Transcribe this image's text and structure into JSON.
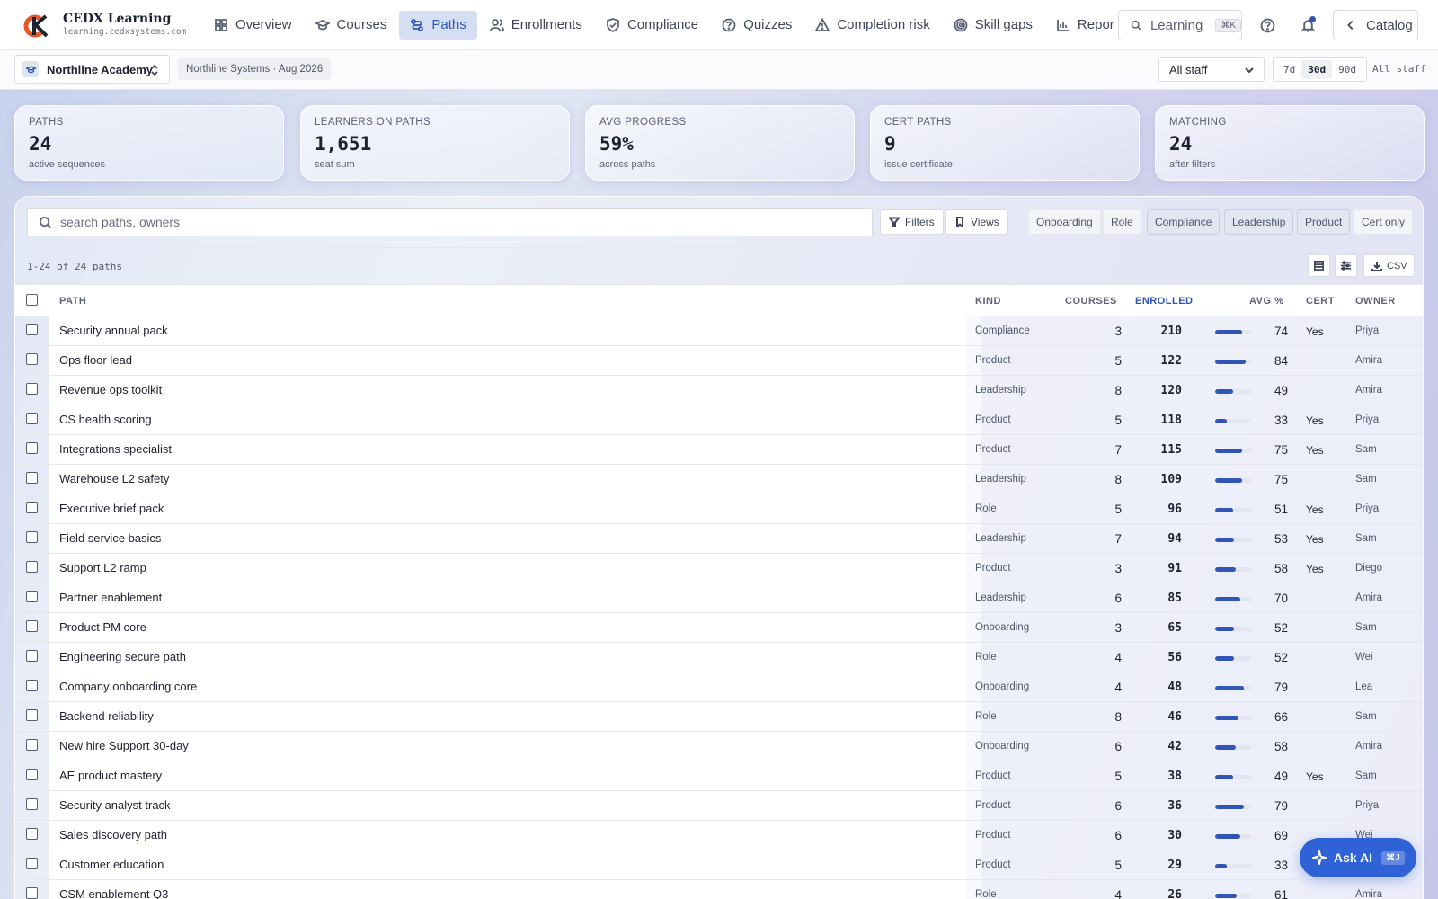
{
  "app": {
    "name": "CEDX Learning",
    "domain": "learning.cedxsystems.com"
  },
  "nav": {
    "items": [
      {
        "label": "Overview",
        "icon": "grid-icon"
      },
      {
        "label": "Courses",
        "icon": "graduation-cap-icon"
      },
      {
        "label": "Paths",
        "icon": "route-icon",
        "active": true
      },
      {
        "label": "Enrollments",
        "icon": "users-icon"
      },
      {
        "label": "Compliance",
        "icon": "shield-check-icon"
      },
      {
        "label": "Quizzes",
        "icon": "help-circle-icon"
      },
      {
        "label": "Completion risk",
        "icon": "alert-triangle-icon"
      },
      {
        "label": "Skill gaps",
        "icon": "target-icon"
      },
      {
        "label": "Repor",
        "icon": "bar-chart-icon"
      }
    ],
    "search_label": "Learning",
    "search_shortcut": "⌘K",
    "catalog_label": "Catalog"
  },
  "subbar": {
    "org": "Northline Academy",
    "org_tag": "Northline Systems · Aug 2026",
    "staff_filter": "All staff",
    "ranges": [
      "7d",
      "30d",
      "90d"
    ],
    "active_range": "30d",
    "range_label": "All staff"
  },
  "stats": [
    {
      "label": "PATHS",
      "value": "24",
      "sub": "active sequences"
    },
    {
      "label": "LEARNERS ON PATHS",
      "value": "1,651",
      "sub": "seat sum"
    },
    {
      "label": "AVG PROGRESS",
      "value": "59%",
      "sub": "across paths"
    },
    {
      "label": "CERT PATHS",
      "value": "9",
      "sub": "issue certificate"
    },
    {
      "label": "MATCHING",
      "value": "24",
      "sub": "after filters"
    }
  ],
  "toolbar": {
    "search_placeholder": "search paths, owners",
    "filters_label": "Filters",
    "views_label": "Views",
    "chips": [
      "Onboarding",
      "Role",
      "Compliance",
      "Leadership",
      "Product",
      "Cert only"
    ],
    "count_text": "1-24 of 24 paths",
    "csv_label": "CSV"
  },
  "table": {
    "columns": {
      "path": "PATH",
      "kind": "KIND",
      "courses": "COURSES",
      "enrolled": "ENROLLED",
      "avg": "AVG %",
      "cert": "CERT",
      "owner": "OWNER"
    },
    "rows": [
      {
        "path": "Security annual pack",
        "kind": "Compliance",
        "courses": "3",
        "enrolled": "210",
        "avg": "74",
        "cert": "Yes",
        "owner": "Priya"
      },
      {
        "path": "Ops floor lead",
        "kind": "Product",
        "courses": "5",
        "enrolled": "122",
        "avg": "84",
        "cert": "",
        "owner": "Amira"
      },
      {
        "path": "Revenue ops toolkit",
        "kind": "Leadership",
        "courses": "8",
        "enrolled": "120",
        "avg": "49",
        "cert": "",
        "owner": "Amira"
      },
      {
        "path": "CS health scoring",
        "kind": "Product",
        "courses": "5",
        "enrolled": "118",
        "avg": "33",
        "cert": "Yes",
        "owner": "Priya"
      },
      {
        "path": "Integrations specialist",
        "kind": "Product",
        "courses": "7",
        "enrolled": "115",
        "avg": "75",
        "cert": "Yes",
        "owner": "Sam"
      },
      {
        "path": "Warehouse L2 safety",
        "kind": "Leadership",
        "courses": "8",
        "enrolled": "109",
        "avg": "75",
        "cert": "",
        "owner": "Sam"
      },
      {
        "path": "Executive brief pack",
        "kind": "Role",
        "courses": "5",
        "enrolled": "96",
        "avg": "51",
        "cert": "Yes",
        "owner": "Priya"
      },
      {
        "path": "Field service basics",
        "kind": "Leadership",
        "courses": "7",
        "enrolled": "94",
        "avg": "53",
        "cert": "Yes",
        "owner": "Sam"
      },
      {
        "path": "Support L2 ramp",
        "kind": "Product",
        "courses": "3",
        "enrolled": "91",
        "avg": "58",
        "cert": "Yes",
        "owner": "Diego"
      },
      {
        "path": "Partner enablement",
        "kind": "Leadership",
        "courses": "6",
        "enrolled": "85",
        "avg": "70",
        "cert": "",
        "owner": "Amira"
      },
      {
        "path": "Product PM core",
        "kind": "Onboarding",
        "courses": "3",
        "enrolled": "65",
        "avg": "52",
        "cert": "",
        "owner": "Sam"
      },
      {
        "path": "Engineering secure path",
        "kind": "Role",
        "courses": "4",
        "enrolled": "56",
        "avg": "52",
        "cert": "",
        "owner": "Wei"
      },
      {
        "path": "Company onboarding core",
        "kind": "Onboarding",
        "courses": "4",
        "enrolled": "48",
        "avg": "79",
        "cert": "",
        "owner": "Lea"
      },
      {
        "path": "Backend reliability",
        "kind": "Role",
        "courses": "8",
        "enrolled": "46",
        "avg": "66",
        "cert": "",
        "owner": "Sam"
      },
      {
        "path": "New hire Support 30-day",
        "kind": "Onboarding",
        "courses": "6",
        "enrolled": "42",
        "avg": "58",
        "cert": "",
        "owner": "Amira"
      },
      {
        "path": "AE product mastery",
        "kind": "Product",
        "courses": "5",
        "enrolled": "38",
        "avg": "49",
        "cert": "Yes",
        "owner": "Sam"
      },
      {
        "path": "Security analyst track",
        "kind": "Product",
        "courses": "6",
        "enrolled": "36",
        "avg": "79",
        "cert": "",
        "owner": "Priya"
      },
      {
        "path": "Sales discovery path",
        "kind": "Product",
        "courses": "6",
        "enrolled": "30",
        "avg": "69",
        "cert": "",
        "owner": "Wei"
      },
      {
        "path": "Customer education",
        "kind": "Product",
        "courses": "5",
        "enrolled": "29",
        "avg": "33",
        "cert": "",
        "owner": ""
      },
      {
        "path": "CSM enablement Q3",
        "kind": "Role",
        "courses": "4",
        "enrolled": "26",
        "avg": "61",
        "cert": "",
        "owner": "Amira"
      }
    ]
  },
  "ask_ai": {
    "label": "Ask AI",
    "shortcut": "⌘J"
  },
  "colors": {
    "accent": "#2f55b5",
    "ask_ai": "#2f62d6"
  }
}
